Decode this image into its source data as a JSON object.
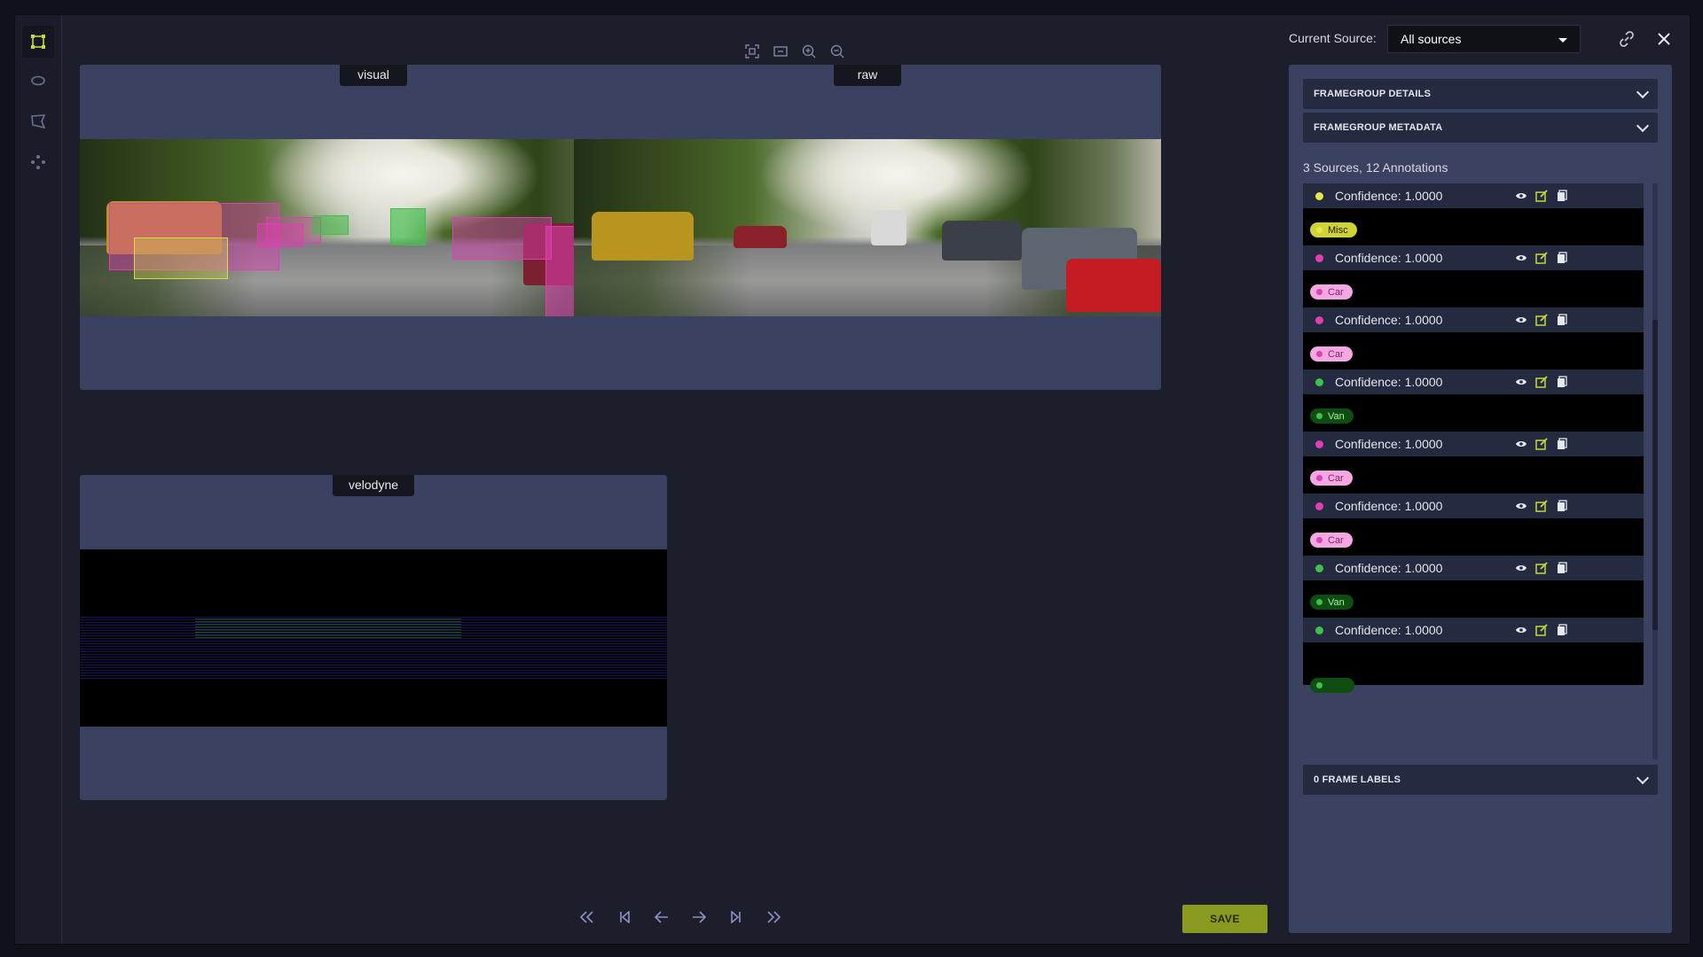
{
  "toolbar": {
    "icons": [
      "fit-screen-icon",
      "fit-width-icon",
      "zoom-in-icon",
      "zoom-out-icon"
    ]
  },
  "viewers": [
    {
      "label": "visual"
    },
    {
      "label": "raw"
    },
    {
      "label": "velodyne"
    }
  ],
  "source": {
    "label": "Current Source:",
    "value": "All sources"
  },
  "panel": {
    "details": "FRAMEGROUP DETAILS",
    "metadata": "FRAMEGROUP METADATA",
    "summary": "3 Sources, 12 Annotations",
    "frame_labels": "0 FRAME LABELS",
    "annotations": [
      {
        "confidence": "Confidence: 1.0000",
        "tag": "Misc",
        "color": "#e6e64a",
        "tag_bg": "#cfd335",
        "tag_fg": "#1b1b05"
      },
      {
        "confidence": "Confidence: 1.0000",
        "tag": "Car",
        "color": "#e03fb4",
        "tag_bg": "#f4a8e2",
        "tag_fg": "#8a1d6e"
      },
      {
        "confidence": "Confidence: 1.0000",
        "tag": "Car",
        "color": "#e03fb4",
        "tag_bg": "#f4a8e2",
        "tag_fg": "#8a1d6e"
      },
      {
        "confidence": "Confidence: 1.0000",
        "tag": "Van",
        "color": "#3fc04a",
        "tag_bg": "#0f4d12",
        "tag_fg": "#9ff0a0"
      },
      {
        "confidence": "Confidence: 1.0000",
        "tag": "Car",
        "color": "#e03fb4",
        "tag_bg": "#f4a8e2",
        "tag_fg": "#8a1d6e"
      },
      {
        "confidence": "Confidence: 1.0000",
        "tag": "Car",
        "color": "#e03fb4",
        "tag_bg": "#f4a8e2",
        "tag_fg": "#8a1d6e"
      },
      {
        "confidence": "Confidence: 1.0000",
        "tag": "Van",
        "color": "#3fc04a",
        "tag_bg": "#0f4d12",
        "tag_fg": "#9ff0a0"
      },
      {
        "confidence": "Confidence: 1.0000",
        "tag": "",
        "color": "#3fc04a",
        "tag_bg": "#0f4d12",
        "tag_fg": "#9ff0a0"
      }
    ]
  },
  "save_label": "SAVE",
  "colors": {
    "accent": "#8a9a1e",
    "panel": "#3a4161",
    "background": "#1c1f2b"
  }
}
